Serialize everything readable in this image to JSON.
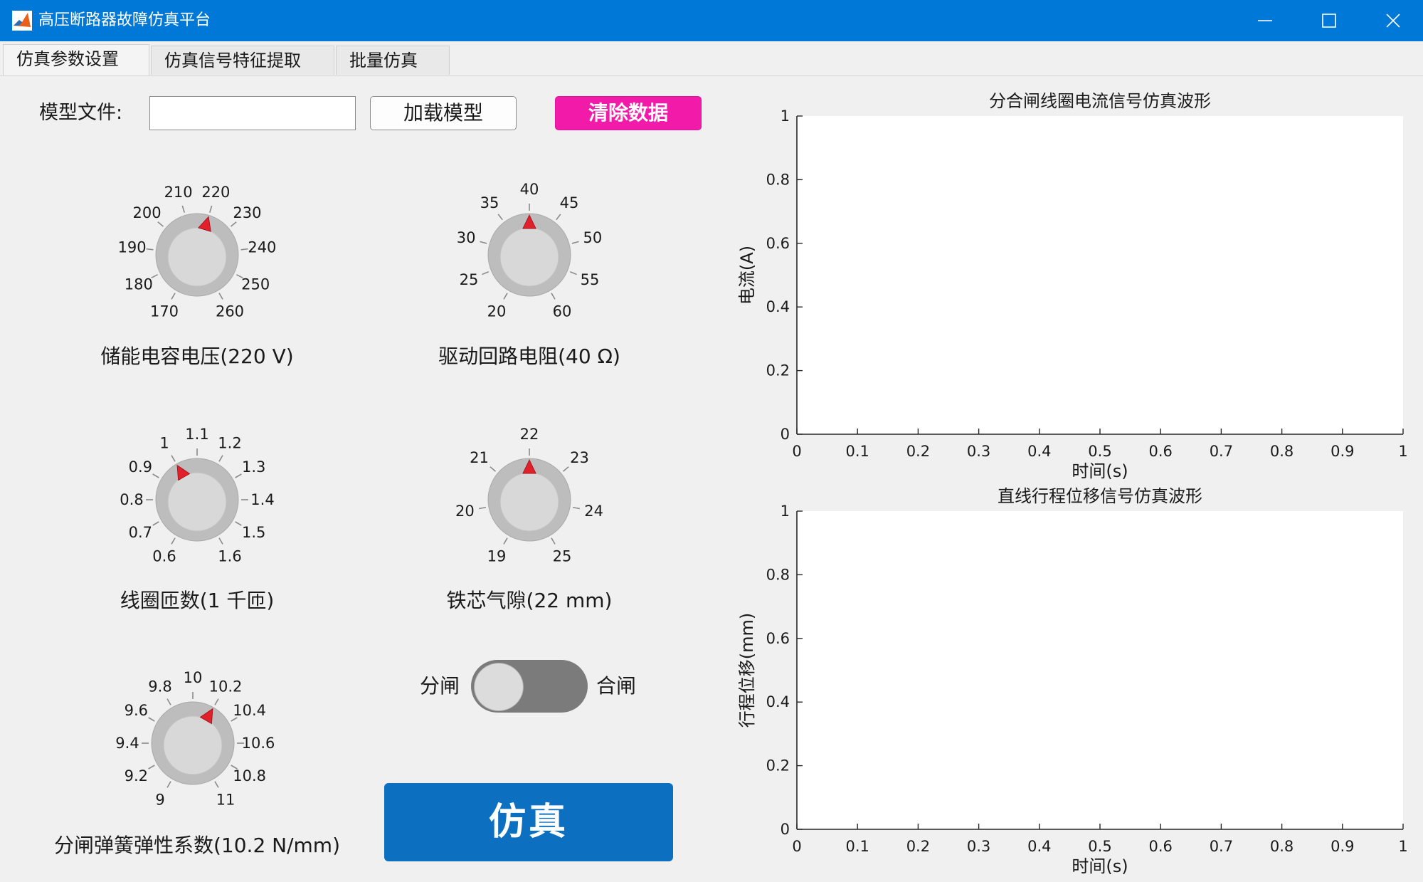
{
  "window": {
    "title": "高压断路器故障仿真平台"
  },
  "tabs": [
    {
      "label": "仿真参数设置",
      "active": true
    },
    {
      "label": "仿真信号特征提取",
      "active": false
    },
    {
      "label": "批量仿真",
      "active": false
    }
  ],
  "model": {
    "file_label": "模型文件:",
    "file_value": "",
    "load_button": "加载模型",
    "clear_button": "清除数据"
  },
  "knobs": [
    {
      "id": "voltage",
      "caption": "储能电容电压(220 V)",
      "ticks": [
        "170",
        "180",
        "190",
        "200",
        "210",
        "220",
        "230",
        "240",
        "250",
        "260"
      ],
      "value": 220,
      "min": 170,
      "max": 260
    },
    {
      "id": "resistance",
      "caption": "驱动回路电阻(40 Ω)",
      "ticks": [
        "20",
        "25",
        "30",
        "35",
        "40",
        "45",
        "50",
        "55",
        "60"
      ],
      "value": 40,
      "min": 20,
      "max": 60
    },
    {
      "id": "turns",
      "caption": "线圈匝数(1 千匝)",
      "ticks": [
        "0.6",
        "0.7",
        "0.8",
        "0.9",
        "1",
        "1.1",
        "1.2",
        "1.3",
        "1.4",
        "1.5",
        "1.6"
      ],
      "value": 1,
      "min": 0.6,
      "max": 1.6
    },
    {
      "id": "gap",
      "caption": "铁芯气隙(22 mm)",
      "ticks": [
        "19",
        "20",
        "21",
        "22",
        "23",
        "24",
        "25"
      ],
      "value": 22,
      "min": 19,
      "max": 25
    },
    {
      "id": "spring",
      "caption": "分闸弹簧弹性系数(10.2 N/mm)",
      "ticks": [
        "9",
        "9.2",
        "9.4",
        "9.6",
        "9.8",
        "10",
        "10.2",
        "10.4",
        "10.6",
        "10.8",
        "11"
      ],
      "value": 10.2,
      "min": 9,
      "max": 11
    }
  ],
  "switch": {
    "left_label": "分闸",
    "right_label": "合闸",
    "state": "分闸"
  },
  "simulate_button": "仿真",
  "colors": {
    "titlebar": "#0078d7",
    "clear_button": "#f21aa9",
    "simulate_button": "#0c6fc0",
    "needle": "#e0202a"
  },
  "plots": [
    {
      "id": "current",
      "title": "分合闸线圈电流信号仿真波形",
      "xlabel": "时间(s)",
      "ylabel": "电流(A)",
      "xlim": [
        0,
        1
      ],
      "ylim": [
        0,
        1
      ],
      "xticks": [
        "0",
        "0.1",
        "0.2",
        "0.3",
        "0.4",
        "0.5",
        "0.6",
        "0.7",
        "0.8",
        "0.9",
        "1"
      ],
      "yticks": [
        "0",
        "0.2",
        "0.4",
        "0.6",
        "0.8",
        "1"
      ]
    },
    {
      "id": "displacement",
      "title": "直线行程位移信号仿真波形",
      "xlabel": "时间(s)",
      "ylabel": "行程位移(mm)",
      "xlim": [
        0,
        1
      ],
      "ylim": [
        0,
        1
      ],
      "xticks": [
        "0",
        "0.1",
        "0.2",
        "0.3",
        "0.4",
        "0.5",
        "0.6",
        "0.7",
        "0.8",
        "0.9",
        "1"
      ],
      "yticks": [
        "0",
        "0.2",
        "0.4",
        "0.6",
        "0.8",
        "1"
      ]
    }
  ]
}
